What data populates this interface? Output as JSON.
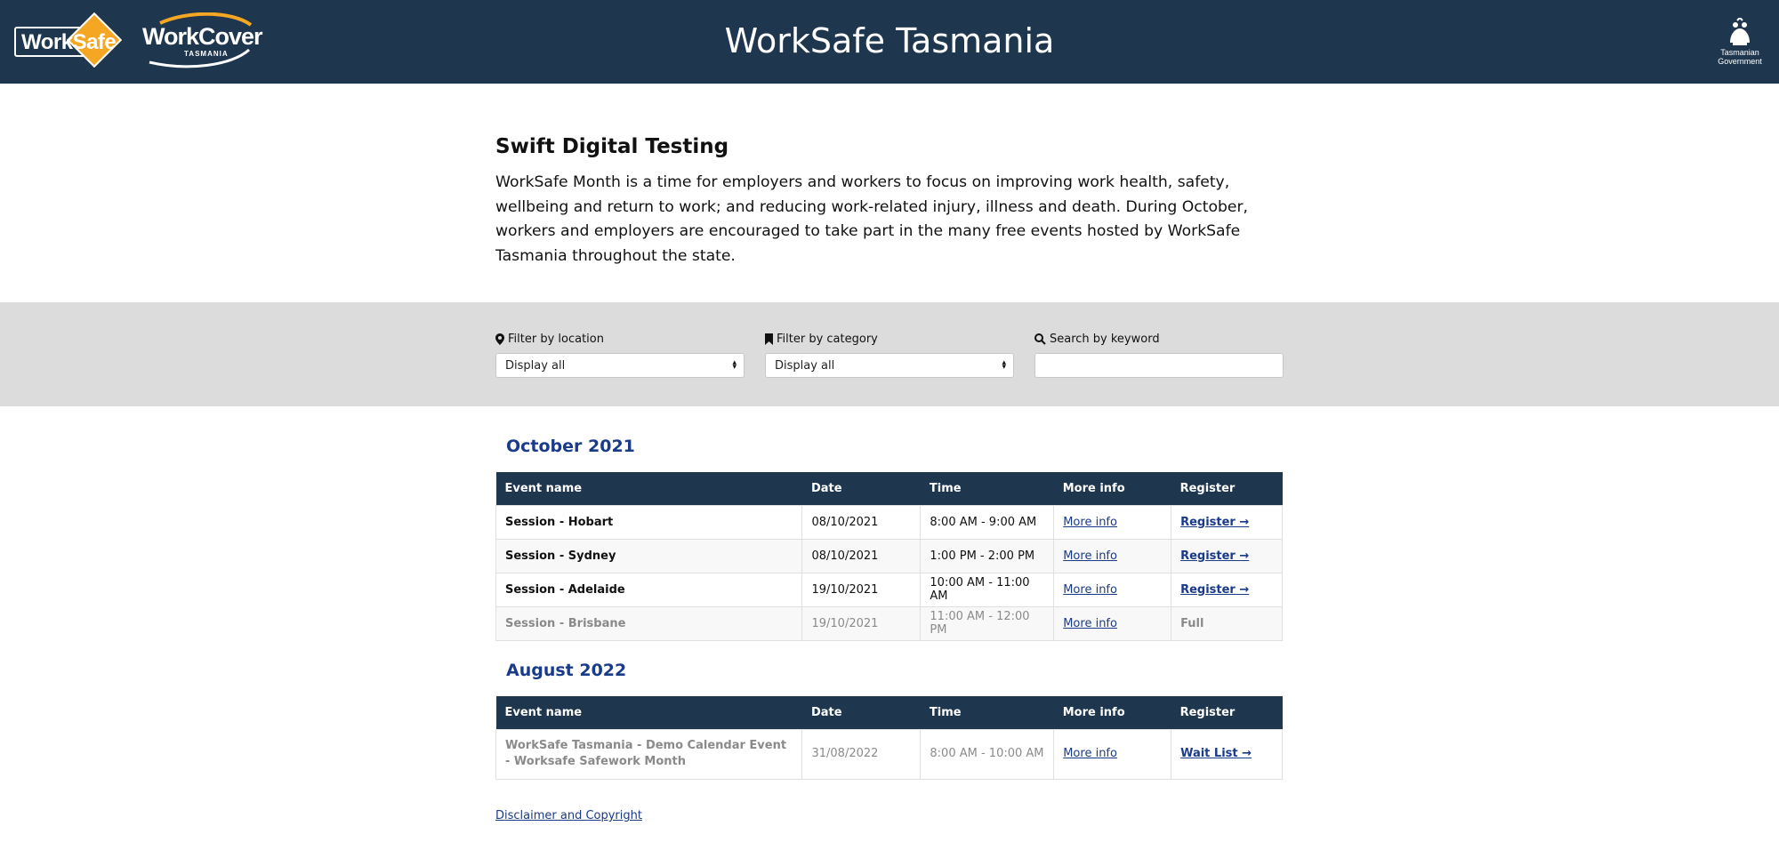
{
  "header": {
    "site_title": "WorkSafe Tasmania",
    "logo_worksafe": "WorkSafe",
    "logo_workcover": "WorkCover",
    "logo_workcover_sub": "TASMANIA",
    "gov_logo_line1": "Tasmanian",
    "gov_logo_line2": "Government"
  },
  "intro": {
    "title": "Swift Digital Testing",
    "body": "WorkSafe Month is a time for employers and workers to focus on improving work health, safety, wellbeing and return to work; and reducing work-related injury, illness and death. During October, workers and employers are encouraged to take part in the many free events hosted by WorkSafe Tasmania throughout the state."
  },
  "filters": {
    "location_label": "Filter by location",
    "location_value": "Display all",
    "category_label": "Filter by category",
    "category_value": "Display all",
    "keyword_label": "Search by keyword",
    "keyword_value": ""
  },
  "table_headers": {
    "event_name": "Event name",
    "date": "Date",
    "time": "Time",
    "more_info": "More info",
    "register": "Register"
  },
  "months": [
    {
      "title": "October 2021",
      "rows": [
        {
          "name": "Session - Hobart",
          "date": "08/10/2021",
          "time": "8:00 AM - 9:00 AM",
          "more_info": "More info",
          "register": "Register →"
        },
        {
          "name": "Session - Sydney",
          "date": "08/10/2021",
          "time": "1:00 PM - 2:00 PM",
          "more_info": "More info",
          "register": "Register →"
        },
        {
          "name": "Session - Adelaide",
          "date": "19/10/2021",
          "time": "10:00 AM - 11:00 AM",
          "more_info": "More info",
          "register": "Register →"
        },
        {
          "name": "Session - Brisbane",
          "date": "19/10/2021",
          "time": "11:00 AM - 12:00 PM",
          "more_info": "More info",
          "register": "Full"
        }
      ]
    },
    {
      "title": "August 2022",
      "rows": [
        {
          "name": "WorkSafe Tasmania - Demo Calendar Event - Worksafe Safework Month",
          "date": "31/08/2022",
          "time": "8:00 AM - 10:00 AM",
          "more_info": "More info",
          "register": "Wait List →"
        }
      ]
    }
  ],
  "footer": {
    "disclaimer": "Disclaimer and Copyright"
  },
  "colors": {
    "header_bg": "#1f364f",
    "accent_orange": "#f5a623",
    "link_blue": "#1a3a8a",
    "filter_bar_bg": "#dcdcdc"
  }
}
